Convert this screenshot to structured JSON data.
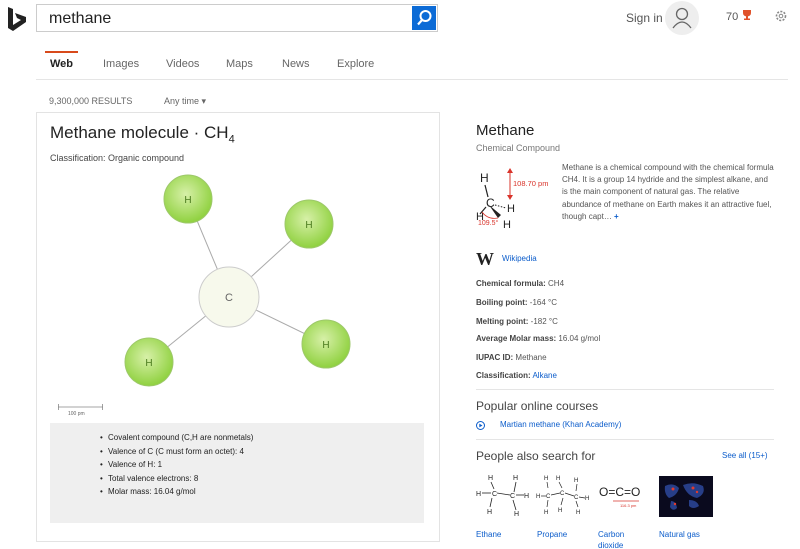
{
  "search": {
    "query": "methane"
  },
  "header": {
    "sign_in": "Sign in",
    "points": "70"
  },
  "tabs": [
    "Web",
    "Images",
    "Videos",
    "Maps",
    "News",
    "Explore"
  ],
  "results_count": "9,300,000 RESULTS",
  "time_filter": "Any time",
  "molecule_card": {
    "title": "Methane molecule · CH",
    "title_subscript": "4",
    "classification": "Classification: Organic compound",
    "atoms": {
      "center": "C",
      "outer": [
        "H",
        "H",
        "H",
        "H"
      ]
    },
    "scale_label": "100 pm",
    "facts": [
      "Covalent compound (C,H are nonmetals)",
      "Valence of C (C must form an octet): 4",
      "Valence of H: 1",
      "Total valence electrons: 8",
      "Molar mass: 16.04 g/mol"
    ]
  },
  "entity": {
    "title": "Methane",
    "subtitle": "Chemical Compound",
    "image": {
      "bond_length": "108.70 pm",
      "bond_angle": "109.5°",
      "atoms": {
        "h": "H",
        "c": "C"
      }
    },
    "description": "Methane is a chemical compound with the chemical formula CH4. It is a group 14 hydride and the simplest alkane, and is the main component of natural gas. The relative abundance of methane on Earth makes it an attractive fuel, though capt…",
    "more": "+",
    "wiki_label": "Wikipedia",
    "wiki_logo": "W",
    "facts": [
      {
        "label": "Chemical formula:",
        "value": "CH4"
      },
      {
        "label": "Boiling point:",
        "value": "-164 °C"
      },
      {
        "label": "Melting point:",
        "value": "-182 °C"
      },
      {
        "label": "Average Molar mass:",
        "value": "16.04 g/mol"
      },
      {
        "label": "IUPAC ID:",
        "value": "Methane"
      },
      {
        "label": "Classification:",
        "value": "Alkane"
      }
    ],
    "courses_heading": "Popular online courses",
    "course": "Martian methane (Khan Academy)",
    "pas_heading": "People also search for",
    "see_all": "See all (15+)",
    "related": [
      {
        "name": "Ethane"
      },
      {
        "name": "Propane"
      },
      {
        "name": "Carbon dioxide",
        "formula": "O=C=O",
        "bond_len": "116.3 pm"
      },
      {
        "name": "Natural gas"
      }
    ]
  },
  "colors": {
    "accent": "#0c6bd6",
    "link": "#0c5dcb",
    "tab_active": "#d84a1b",
    "atom_h": "#8fd13f",
    "atom_c": "#f7f9ec"
  }
}
